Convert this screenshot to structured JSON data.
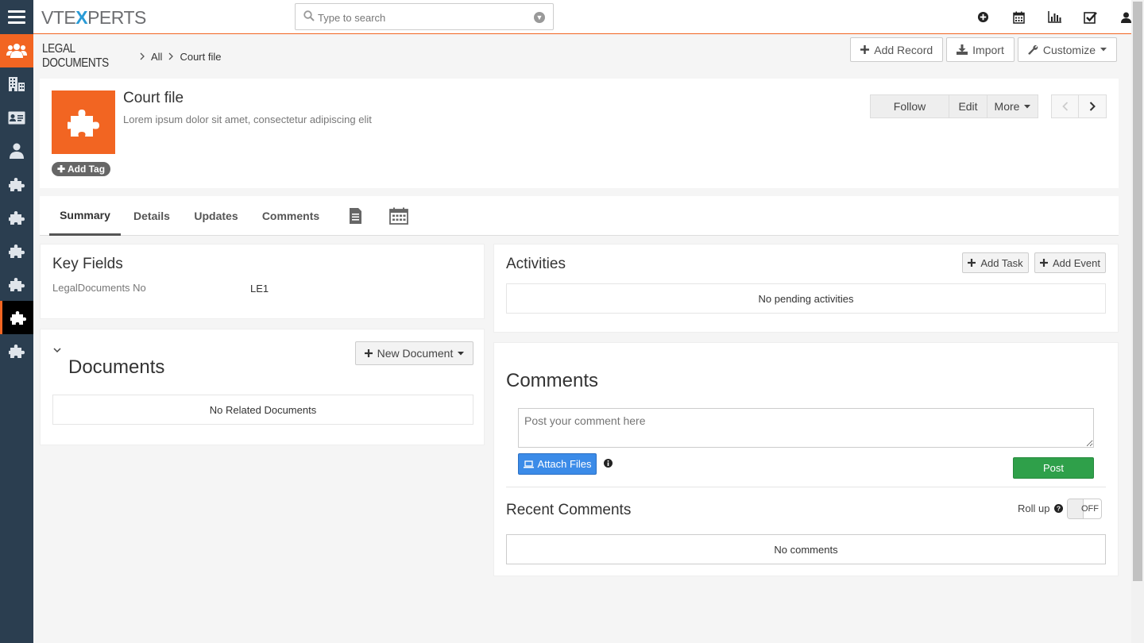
{
  "app": {
    "logo_prefix": "VTE",
    "logo_x": "X",
    "logo_suffix": "PERTS"
  },
  "search": {
    "placeholder": "Type to search"
  },
  "top_icons": [
    "plus-circle-icon",
    "calendar-icon",
    "bar-chart-icon",
    "check-square-icon",
    "user-icon"
  ],
  "sidebar": {
    "items": [
      "users-icon",
      "building-icon",
      "contact-card-icon",
      "person-icon",
      "puzzle-icon",
      "puzzle-icon",
      "puzzle-icon",
      "puzzle-icon",
      "puzzle-icon",
      "puzzle-icon"
    ]
  },
  "breadcrumb": {
    "module": "LEGAL DOCUMENTS",
    "filter": "All",
    "record": "Court file"
  },
  "header_actions": {
    "add_record": "Add Record",
    "import": "Import",
    "customize": "Customize"
  },
  "record": {
    "title": "Court file",
    "description": "Lorem ipsum dolor sit amet, consectetur adipiscing elit",
    "add_tag": "Add Tag",
    "follow": "Follow",
    "edit": "Edit",
    "more": "More"
  },
  "tabs": {
    "summary": "Summary",
    "details": "Details",
    "updates": "Updates",
    "comments": "Comments"
  },
  "key_fields": {
    "title": "Key Fields",
    "label": "LegalDocuments No",
    "value": "LE1"
  },
  "documents": {
    "title": "Documents",
    "new_button": "New Document",
    "empty": "No Related Documents"
  },
  "activities": {
    "title": "Activities",
    "add_task": "Add Task",
    "add_event": "Add Event",
    "empty": "No pending activities"
  },
  "comments": {
    "title": "Comments",
    "placeholder": "Post your comment here",
    "attach": "Attach Files",
    "post": "Post",
    "recent_title": "Recent Comments",
    "roll_up": "Roll up",
    "toggle_state": "OFF",
    "empty": "No comments"
  },
  "colors": {
    "accent": "#f26522",
    "sidebar": "#2b3e50",
    "post": "#2fa04a",
    "attach": "#3b8be8"
  }
}
